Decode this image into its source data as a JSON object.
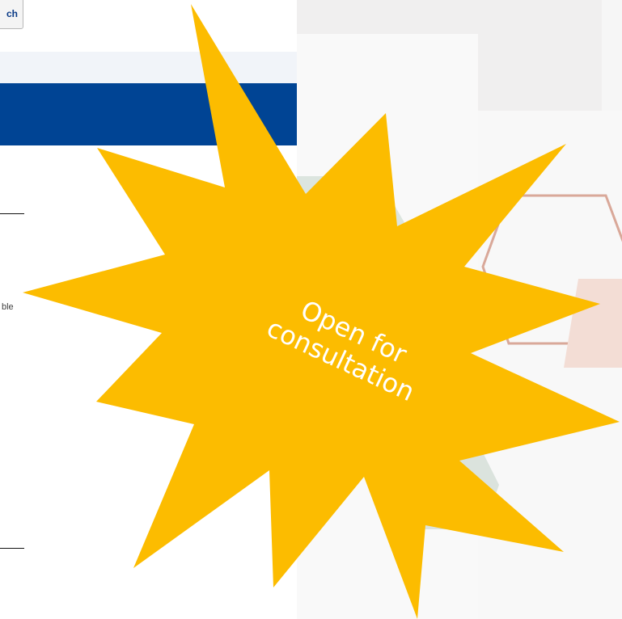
{
  "header": {
    "search_label": "ch"
  },
  "body": {
    "text_fragment": "ble"
  },
  "badge": {
    "label": "Open for consultation",
    "line1": "Open for",
    "line2": "consultation",
    "color": "#fcbc00"
  },
  "colors": {
    "header_bar": "#004494",
    "nav_strip": "#f1f4f9",
    "search_text": "#0a3a86"
  }
}
